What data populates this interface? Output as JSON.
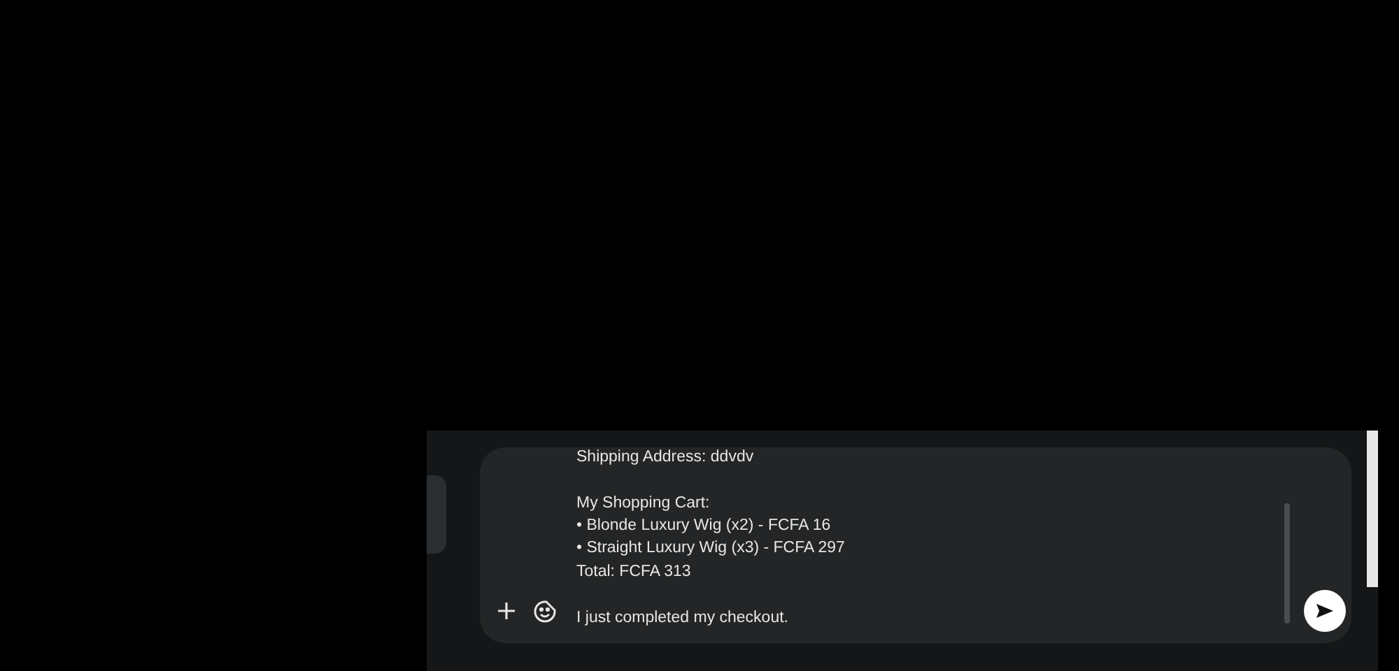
{
  "composer": {
    "paragraphs": [
      [
        "Shipping Address: ddvdv"
      ],
      [
        "My Shopping Cart:",
        "• Blonde Luxury Wig (x2) - FCFA 16",
        "• Straight Luxury Wig (x3) - FCFA 297",
        "Total: FCFA 313"
      ],
      [
        "I just completed my checkout."
      ]
    ]
  }
}
